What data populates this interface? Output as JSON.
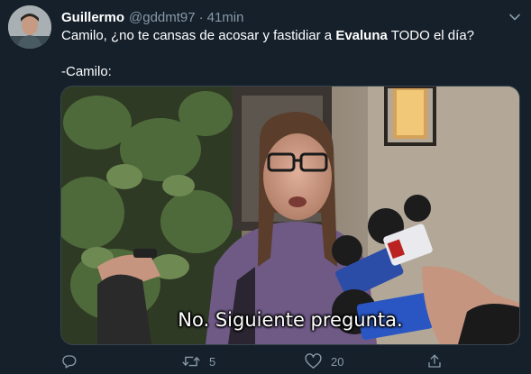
{
  "tweet": {
    "display_name": "Guillermo",
    "handle": "@gddmt97",
    "separator": "·",
    "time": "41min",
    "text_before": "Camilo, ¿no te cansas de acosar y fastidiar a ",
    "text_bold": "Evaluna",
    "text_after": " TODO el día?",
    "text_line2": "-Camilo:"
  },
  "media": {
    "subtitle": "No. Siguiente pregunta."
  },
  "actions": {
    "reply_count": "",
    "retweet_count": "5",
    "like_count": "20"
  },
  "colors": {
    "background": "#15202b",
    "secondary_text": "#8899a6",
    "primary_text": "#ffffff"
  },
  "icons": {
    "reply": "reply-icon",
    "retweet": "retweet-icon",
    "like": "heart-icon",
    "share": "share-icon",
    "caret": "chevron-down-icon"
  }
}
